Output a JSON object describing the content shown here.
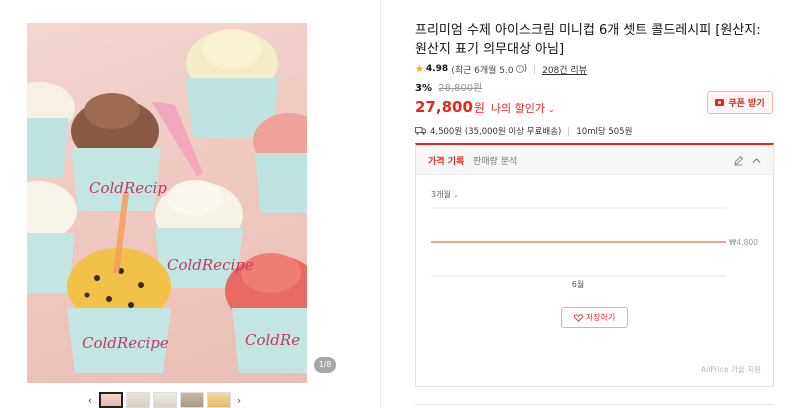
{
  "gallery": {
    "counter": "1/8",
    "hero_alt": "ColdRecipe ice cream cups",
    "cup_brand": "ColdRecipe",
    "prev_icon": "chevron-left-icon",
    "next_icon": "chevron-right-icon",
    "thumbnail_count": 5,
    "active_thumbnail": 1
  },
  "product": {
    "title": "프리미엄 수제 아이스크림 미니컵 6개 셋트 콜드레시피 [원산지: 원산지 표기 의무대상 아님]",
    "rating": {
      "score": "4.98",
      "period_text": "(최근 6개월 5.0",
      "info_icon": "ⓘ",
      "close_paren": ")",
      "review_count": "208건 리뷰"
    },
    "price": {
      "discount_rate": "3%",
      "original_price": "28,800원",
      "sale_price": "27,800",
      "currency": "원",
      "my_discount_label": "나의 할인가",
      "caret": "⌄"
    },
    "coupon_button": "쿠폰 받기",
    "shipping": {
      "text": "4,500원 (35,000원 이상 무료배송)",
      "unit_price": "10ml당 505원"
    }
  },
  "price_history": {
    "tabs": [
      "가격 기록",
      "판매량 분석"
    ],
    "period": "3개월",
    "chart_value_label": "₩4,800",
    "x_label": "6월",
    "save_button": "저장하기",
    "credit": "AliPrice 기술 지원"
  },
  "colors": {
    "accent": "#e8281f",
    "price_line": "#f08a5d",
    "star": "#f5a623"
  }
}
